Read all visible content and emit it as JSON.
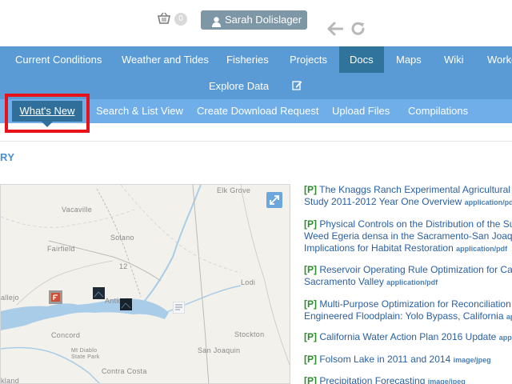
{
  "header": {
    "basket_count": "0",
    "user_name": "Sarah Dolislager"
  },
  "nav_primary": {
    "items": [
      "Current Conditions",
      "Weather and Tides",
      "Fisheries",
      "Projects",
      "Docs",
      "Maps",
      "Wiki",
      "Workg"
    ],
    "active": "Docs",
    "row2_item": "Explore Data"
  },
  "nav_secondary": {
    "items": [
      "What's New",
      "Search & List View",
      "Create Download Request",
      "Upload Files",
      "Compilations"
    ],
    "active": "What's New"
  },
  "section_label": "RY",
  "map": {
    "labels": [
      "Elk Grove",
      "Vacaville",
      "Solano",
      "Fairfield",
      "12",
      "Lodi",
      "allejo",
      "Antioch",
      "Concord",
      "Stockton",
      "San Joaquin",
      "Mt Diablo State Park",
      "Contra Costa",
      "kland"
    ],
    "colors": {
      "land": "#f3f1ec",
      "water": "#a9cde8",
      "road": "#bbbbbb"
    }
  },
  "results": [
    {
      "tag": "[P]",
      "lines": [
        "The Knaggs Ranch Experimental Agricultural",
        "Study 2011-2012 Year One Overview"
      ],
      "mime": "application/pdf"
    },
    {
      "tag": "[P]",
      "lines": [
        "Physical Controls on the Distribution of the Su",
        "Weed Egeria densa in the Sacramento-San Joaqu",
        "Implications for Habitat Restoration"
      ],
      "mime": "application/pdf"
    },
    {
      "tag": "[P]",
      "lines": [
        "Reservoir Operating Rule Optimization for Ca",
        "Sacramento Valley"
      ],
      "mime": "application/pdf"
    },
    {
      "tag": "[P]",
      "lines": [
        "Multi-Purpose Optimization for Reconciliation",
        "Engineered Floodplain: Yolo Bypass, California"
      ],
      "mime": "appl"
    },
    {
      "tag": "[P]",
      "lines": [
        "California Water Action Plan 2016 Update"
      ],
      "mime": "appl"
    },
    {
      "tag": "[P]",
      "lines": [
        "Folsom Lake in 2011 and 2014"
      ],
      "mime": "image/jpeg"
    },
    {
      "tag": "[P]",
      "lines": [
        "Precipitation Forecasting"
      ],
      "mime": "image/jpeg"
    }
  ]
}
